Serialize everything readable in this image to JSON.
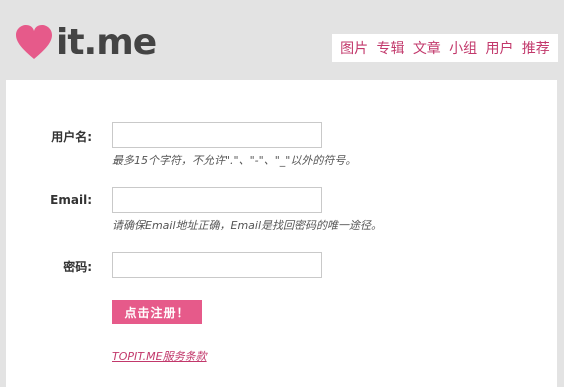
{
  "brand": {
    "logo_text": "it.me",
    "accent_color": "#e65a8a",
    "link_color": "#c2386b"
  },
  "nav": {
    "items": [
      {
        "label": "图片"
      },
      {
        "label": "专辑"
      },
      {
        "label": "文章"
      },
      {
        "label": "小组"
      },
      {
        "label": "用户"
      },
      {
        "label": "推荐"
      }
    ]
  },
  "form": {
    "username": {
      "label": "用户名:",
      "value": "",
      "hint": "最多15个字符，不允许\".\"、\"-\"、\"_\"以外的符号。"
    },
    "email": {
      "label": "Email:",
      "value": "",
      "hint": "请确保Email地址正确，Email是找回密码的唯一途径。"
    },
    "password": {
      "label": "密码:",
      "value": ""
    },
    "submit_label": "点击注册！",
    "terms_link": "TOPIT.ME服务条款"
  }
}
